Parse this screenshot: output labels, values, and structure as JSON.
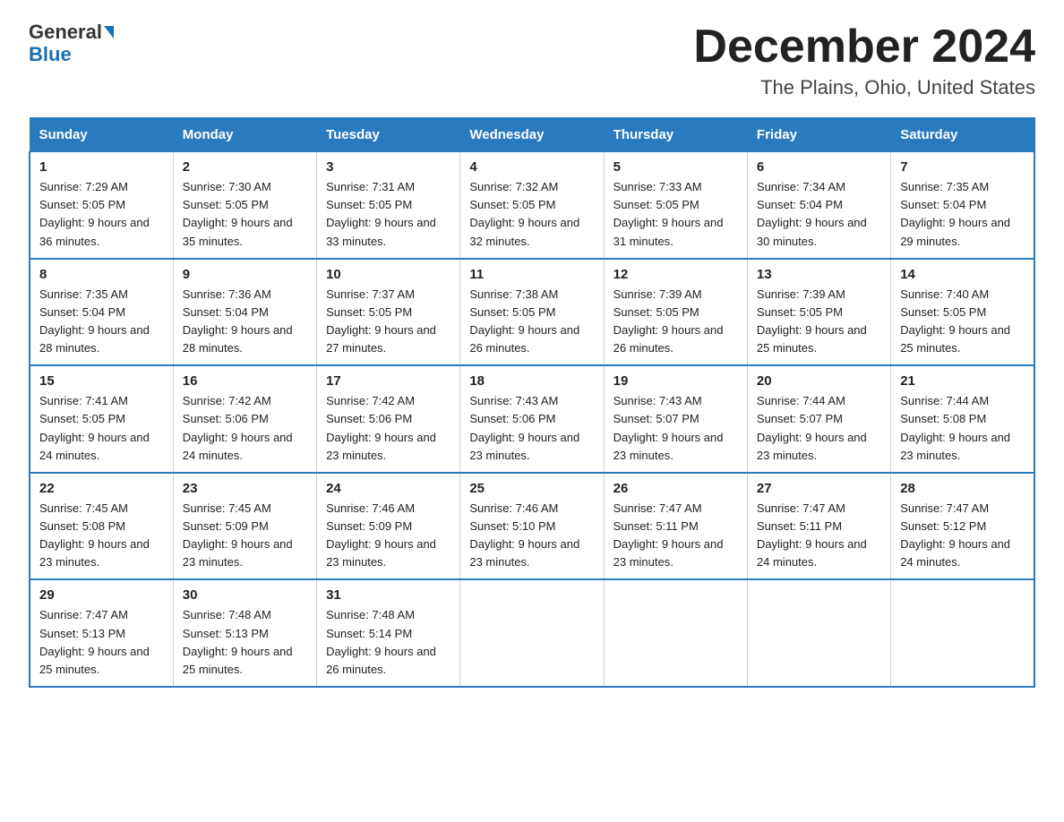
{
  "logo": {
    "line1": "General",
    "arrow": "▶",
    "line2": "Blue"
  },
  "title": "December 2024",
  "subtitle": "The Plains, Ohio, United States",
  "weekdays": [
    "Sunday",
    "Monday",
    "Tuesday",
    "Wednesday",
    "Thursday",
    "Friday",
    "Saturday"
  ],
  "weeks": [
    [
      {
        "day": "1",
        "sunrise": "7:29 AM",
        "sunset": "5:05 PM",
        "daylight": "9 hours and 36 minutes."
      },
      {
        "day": "2",
        "sunrise": "7:30 AM",
        "sunset": "5:05 PM",
        "daylight": "9 hours and 35 minutes."
      },
      {
        "day": "3",
        "sunrise": "7:31 AM",
        "sunset": "5:05 PM",
        "daylight": "9 hours and 33 minutes."
      },
      {
        "day": "4",
        "sunrise": "7:32 AM",
        "sunset": "5:05 PM",
        "daylight": "9 hours and 32 minutes."
      },
      {
        "day": "5",
        "sunrise": "7:33 AM",
        "sunset": "5:05 PM",
        "daylight": "9 hours and 31 minutes."
      },
      {
        "day": "6",
        "sunrise": "7:34 AM",
        "sunset": "5:04 PM",
        "daylight": "9 hours and 30 minutes."
      },
      {
        "day": "7",
        "sunrise": "7:35 AM",
        "sunset": "5:04 PM",
        "daylight": "9 hours and 29 minutes."
      }
    ],
    [
      {
        "day": "8",
        "sunrise": "7:35 AM",
        "sunset": "5:04 PM",
        "daylight": "9 hours and 28 minutes."
      },
      {
        "day": "9",
        "sunrise": "7:36 AM",
        "sunset": "5:04 PM",
        "daylight": "9 hours and 28 minutes."
      },
      {
        "day": "10",
        "sunrise": "7:37 AM",
        "sunset": "5:05 PM",
        "daylight": "9 hours and 27 minutes."
      },
      {
        "day": "11",
        "sunrise": "7:38 AM",
        "sunset": "5:05 PM",
        "daylight": "9 hours and 26 minutes."
      },
      {
        "day": "12",
        "sunrise": "7:39 AM",
        "sunset": "5:05 PM",
        "daylight": "9 hours and 26 minutes."
      },
      {
        "day": "13",
        "sunrise": "7:39 AM",
        "sunset": "5:05 PM",
        "daylight": "9 hours and 25 minutes."
      },
      {
        "day": "14",
        "sunrise": "7:40 AM",
        "sunset": "5:05 PM",
        "daylight": "9 hours and 25 minutes."
      }
    ],
    [
      {
        "day": "15",
        "sunrise": "7:41 AM",
        "sunset": "5:05 PM",
        "daylight": "9 hours and 24 minutes."
      },
      {
        "day": "16",
        "sunrise": "7:42 AM",
        "sunset": "5:06 PM",
        "daylight": "9 hours and 24 minutes."
      },
      {
        "day": "17",
        "sunrise": "7:42 AM",
        "sunset": "5:06 PM",
        "daylight": "9 hours and 23 minutes."
      },
      {
        "day": "18",
        "sunrise": "7:43 AM",
        "sunset": "5:06 PM",
        "daylight": "9 hours and 23 minutes."
      },
      {
        "day": "19",
        "sunrise": "7:43 AM",
        "sunset": "5:07 PM",
        "daylight": "9 hours and 23 minutes."
      },
      {
        "day": "20",
        "sunrise": "7:44 AM",
        "sunset": "5:07 PM",
        "daylight": "9 hours and 23 minutes."
      },
      {
        "day": "21",
        "sunrise": "7:44 AM",
        "sunset": "5:08 PM",
        "daylight": "9 hours and 23 minutes."
      }
    ],
    [
      {
        "day": "22",
        "sunrise": "7:45 AM",
        "sunset": "5:08 PM",
        "daylight": "9 hours and 23 minutes."
      },
      {
        "day": "23",
        "sunrise": "7:45 AM",
        "sunset": "5:09 PM",
        "daylight": "9 hours and 23 minutes."
      },
      {
        "day": "24",
        "sunrise": "7:46 AM",
        "sunset": "5:09 PM",
        "daylight": "9 hours and 23 minutes."
      },
      {
        "day": "25",
        "sunrise": "7:46 AM",
        "sunset": "5:10 PM",
        "daylight": "9 hours and 23 minutes."
      },
      {
        "day": "26",
        "sunrise": "7:47 AM",
        "sunset": "5:11 PM",
        "daylight": "9 hours and 23 minutes."
      },
      {
        "day": "27",
        "sunrise": "7:47 AM",
        "sunset": "5:11 PM",
        "daylight": "9 hours and 24 minutes."
      },
      {
        "day": "28",
        "sunrise": "7:47 AM",
        "sunset": "5:12 PM",
        "daylight": "9 hours and 24 minutes."
      }
    ],
    [
      {
        "day": "29",
        "sunrise": "7:47 AM",
        "sunset": "5:13 PM",
        "daylight": "9 hours and 25 minutes."
      },
      {
        "day": "30",
        "sunrise": "7:48 AM",
        "sunset": "5:13 PM",
        "daylight": "9 hours and 25 minutes."
      },
      {
        "day": "31",
        "sunrise": "7:48 AM",
        "sunset": "5:14 PM",
        "daylight": "9 hours and 26 minutes."
      },
      null,
      null,
      null,
      null
    ]
  ],
  "labels": {
    "sunrise_prefix": "Sunrise: ",
    "sunset_prefix": "Sunset: ",
    "daylight_prefix": "Daylight: "
  }
}
